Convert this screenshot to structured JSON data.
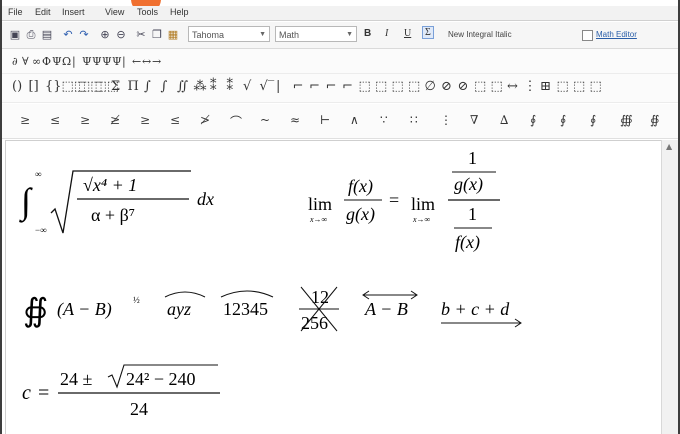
{
  "menu": [
    "File",
    "Edit",
    "Insert",
    "View",
    "Tools",
    "Help"
  ],
  "toolbar": {
    "font_value": "Tahoma",
    "style_value": "Math",
    "bold": "B",
    "italic": "I",
    "underline": "U",
    "sigma": "Σ",
    "new_integral_label": "New Integral Italic",
    "math_editor_link": "Math Editor"
  },
  "symbol_rows": [
    [
      "∂",
      "∀",
      "∞",
      "Φ",
      "Ψ",
      "Ω",
      "|",
      "Ψ",
      "Ψ",
      "Ψ",
      "Ψ",
      "|",
      "←",
      "↔",
      "→"
    ],
    [
      "()",
      "[]",
      "{}",
      "⬚⬚",
      "⬚⬚",
      "⬚⬚",
      "Σ",
      "Π",
      "∫",
      "∫",
      "∬",
      "⁂",
      "⁑",
      "⁑",
      "√",
      "√‾",
      "|",
      "⌐",
      "⌐",
      "⌐",
      "⌐",
      "⬚",
      "⬚",
      "⬚",
      "⬚",
      "∅",
      "⊘",
      "⊘",
      "⬚",
      "⬚",
      "↔",
      "⋮",
      "⊞",
      "⬚",
      "⬚",
      "⬚"
    ],
    [
      "≥",
      "≤",
      "≥",
      "≱",
      "≥",
      "≤",
      "≯",
      "⌒",
      "~",
      "≈",
      "⊢",
      "∧",
      "∵",
      "∷",
      "⋮",
      "∇",
      "∆",
      "∮",
      "∮",
      "∮",
      "∰",
      "∯"
    ]
  ],
  "equations": {
    "eq1": {
      "int_upper": "∞",
      "int_lower": "−∞",
      "numerator": "√x⁴ + 1",
      "denominator": "α + β⁷",
      "suffix": "dx"
    },
    "eq2": {
      "lim": "lim",
      "lim_sub": "x→∞",
      "f_num": "f(x)",
      "f_den": "g(x)",
      "equals": "=",
      "one": "1",
      "g_x": "g(x)",
      "f_x": "f(x)"
    },
    "row3": {
      "contour": "∯",
      "paren_expr": "(A − B)",
      "paren_exp": "½",
      "arc_ayz": "ayz",
      "arc_num": "12345",
      "cancel_num": "12",
      "cancel_den": "256",
      "vector": "A − B",
      "underarrow": "b + c + d"
    },
    "eq4": {
      "lhs": "c",
      "equals": "=",
      "num_prefix": "24 ±",
      "radicand": "24² − 240",
      "denominator": "24"
    }
  }
}
